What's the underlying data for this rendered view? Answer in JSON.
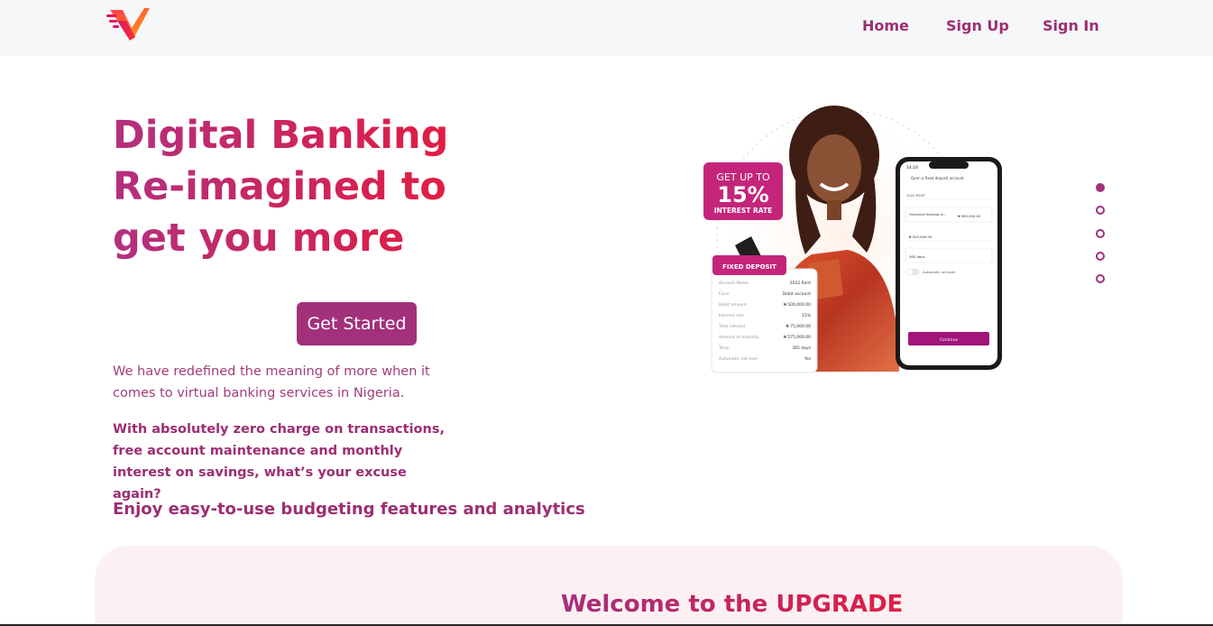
{
  "nav": {
    "home": "Home",
    "sign_up": "Sign Up",
    "sign_in": "Sign In"
  },
  "hero": {
    "title_lines": [
      "Digital Banking",
      "Re-imagined to",
      "get you more"
    ],
    "cta_label": "Get Started",
    "description": "We have redefined the meaning of more when it comes to virtual banking services in Nigeria.",
    "highlight": "With absolutely zero charge on transactions, free account maintenance and monthly interest on savings, what’s your excuse again?",
    "feature": "Enjoy easy-to-use budgeting features and analytics"
  },
  "promo": {
    "badge_line1": "GET UP TO",
    "badge_rate": "15%",
    "badge_line2": "INTEREST RATE",
    "card_title": "FIXED DEPOSIT",
    "card_rows": [
      {
        "label": "Account Name",
        "value": "2022 Rent"
      },
      {
        "label": "Fund",
        "value": "Debit account"
      },
      {
        "label": "Debit amount",
        "value": "₦ 500,000.00"
      },
      {
        "label": "Interest rate",
        "value": "15%"
      },
      {
        "label": "Total interest",
        "value": "₦ 75,000.00"
      },
      {
        "label": "Amount at maturity",
        "value": "₦ 575,000.00"
      },
      {
        "label": "Tenor",
        "value": "365 days"
      },
      {
        "label": "Automatic roll-over",
        "value": "Yes"
      }
    ],
    "phone_time": "14:24",
    "phone_header": "Open a fixed deposit account",
    "phone_field_name": "2022 RENT",
    "phone_account": "Universal Savings A...",
    "phone_account_amount": "₦ 999,000.00",
    "phone_amount": "₦ 500,000.00",
    "phone_duration": "365 days",
    "phone_toggle_label": "Automatic roll-over",
    "phone_button": "Continue"
  },
  "carousel": {
    "slide_count": 5,
    "active_index": 0
  },
  "welcome": {
    "title": "Welcome to the UPGRADE"
  },
  "colors": {
    "brand_purple": "#a2307a",
    "brand_red": "#e81a3a",
    "nav_bg": "#f6f7f9",
    "panel_bg": "#fcf0f3"
  }
}
